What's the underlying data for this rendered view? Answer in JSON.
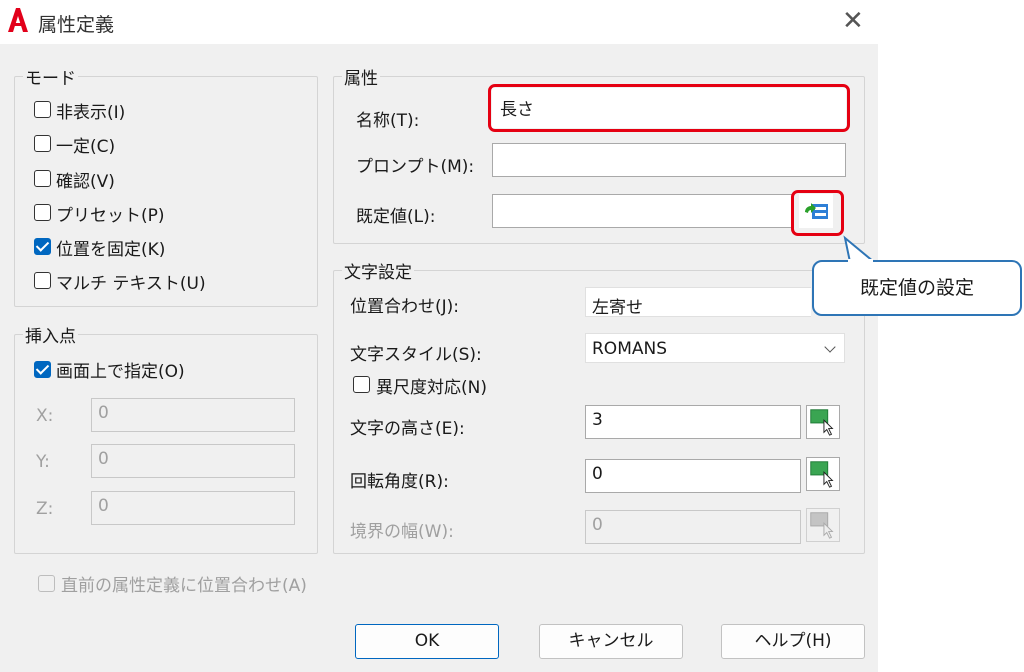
{
  "window": {
    "title": "属性定義",
    "close_glyph": "✕"
  },
  "mode": {
    "legend": "モード",
    "items": [
      {
        "label": "非表示(I)",
        "checked": false
      },
      {
        "label": "一定(C)",
        "checked": false
      },
      {
        "label": "確認(V)",
        "checked": false
      },
      {
        "label": "プリセット(P)",
        "checked": false
      },
      {
        "label": "位置を固定(K)",
        "checked": true
      },
      {
        "label": "マルチ テキスト(U)",
        "checked": false
      }
    ]
  },
  "insert": {
    "legend": "挿入点",
    "specify_label": "画面上で指定(O)",
    "x_label": "X:",
    "x_value": "0",
    "y_label": "Y:",
    "y_value": "0",
    "z_label": "Z:",
    "z_value": "0"
  },
  "attribute": {
    "legend": "属性",
    "tag_label": "名称(T):",
    "tag_value": "長さ",
    "prompt_label": "プロンプト(M):",
    "prompt_value": "",
    "default_label": "既定値(L):",
    "default_value": ""
  },
  "text": {
    "legend": "文字設定",
    "justify_label": "位置合わせ(J):",
    "justify_value": "左寄せ",
    "style_label": "文字スタイル(S):",
    "style_value": "ROMANS",
    "annotative_label": "異尺度対応(N)",
    "height_label": "文字の高さ(E):",
    "height_value": "3",
    "rotation_label": "回転角度(R):",
    "rotation_value": "0",
    "width_label": "境界の幅(W):",
    "width_value": "0"
  },
  "align_below_label": "直前の属性定義に位置合わせ(A)",
  "buttons": {
    "ok": "OK",
    "cancel": "キャンセル",
    "help": "ヘルプ(H)"
  },
  "callout": {
    "text": "既定値の設定"
  },
  "colors": {
    "highlight": "#e50012",
    "accent": "#0067c0",
    "callout_border": "#2e75b6"
  },
  "icons": {
    "app": "autocad-logo-icon",
    "field": "insert-field-icon",
    "pick": "pick-point-icon"
  }
}
